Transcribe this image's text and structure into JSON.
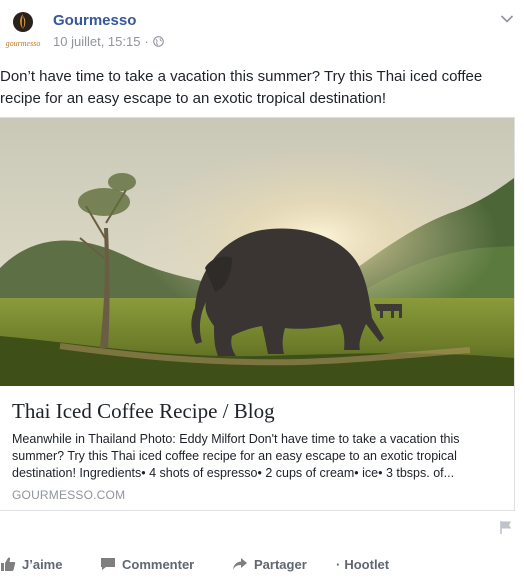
{
  "post": {
    "page_name": "Gourmesso",
    "avatar_text": "gourmesso",
    "date": "10 juillet, 15:15",
    "separator": "·",
    "text": "Don’t have time to take a vacation this summer? Try this Thai iced coffee recipe for an easy escape to an exotic tropical destination!"
  },
  "link_card": {
    "image_icon": "elephant-landscape-photo",
    "title": "Thai Iced Coffee Recipe / Blog",
    "description": "Meanwhile in Thailand Photo: Eddy Milfort Don't have time to take a vacation this summer? Try this Thai iced coffee recipe for an easy escape to an exotic tropical destination! Ingredients• 4 shots of espresso• 2 cups of cream• ice• 3 tbsps. of...",
    "domain": "GOURMESSO.COM"
  },
  "actions": {
    "like": "J’aime",
    "comment": "Commenter",
    "share": "Partager",
    "hootlet_prefix": "·",
    "hootlet": "Hootlet"
  },
  "colors": {
    "link": "#365899",
    "meta": "#90949c",
    "text": "#1d2129",
    "action": "#616770"
  }
}
